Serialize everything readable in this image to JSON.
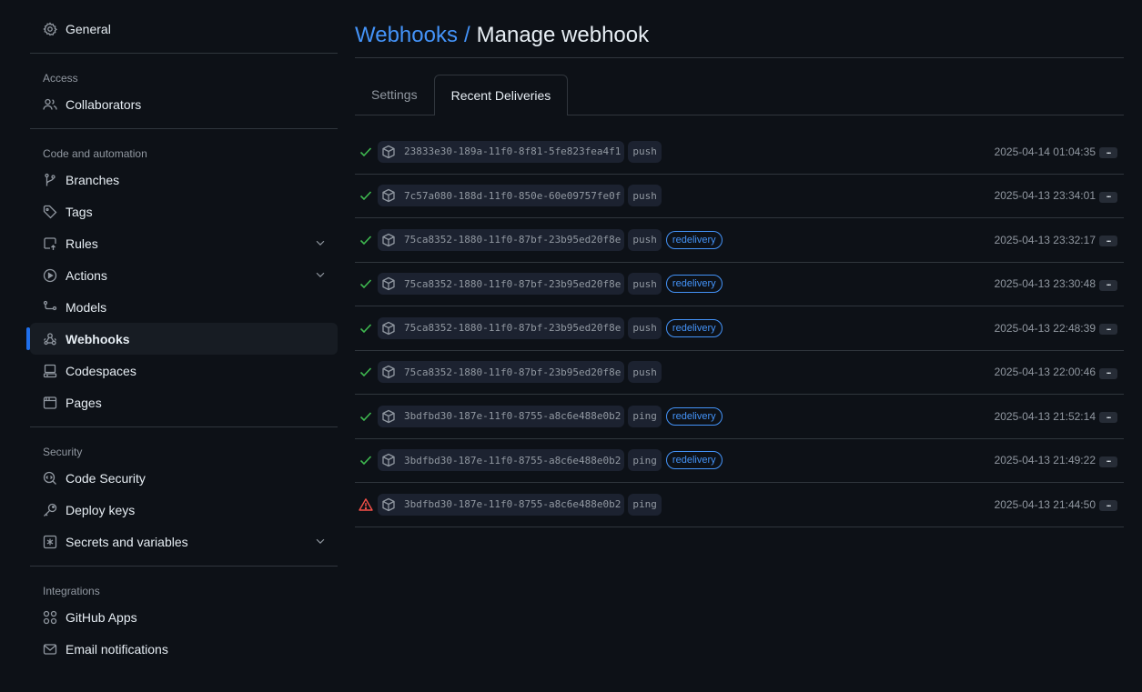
{
  "sidebar": {
    "general": {
      "label": "General",
      "icon": "gear-icon"
    },
    "sections": [
      {
        "heading": "Access",
        "items": [
          {
            "label": "Collaborators",
            "icon": "people-icon"
          }
        ]
      },
      {
        "heading": "Code and automation",
        "items": [
          {
            "label": "Branches",
            "icon": "branch-icon"
          },
          {
            "label": "Tags",
            "icon": "tag-icon"
          },
          {
            "label": "Rules",
            "icon": "rules-icon",
            "expandable": true
          },
          {
            "label": "Actions",
            "icon": "play-icon",
            "expandable": true
          },
          {
            "label": "Models",
            "icon": "models-icon"
          },
          {
            "label": "Webhooks",
            "icon": "webhook-icon",
            "active": true
          },
          {
            "label": "Codespaces",
            "icon": "codespaces-icon"
          },
          {
            "label": "Pages",
            "icon": "browser-icon"
          }
        ]
      },
      {
        "heading": "Security",
        "items": [
          {
            "label": "Code Security",
            "icon": "codescan-icon"
          },
          {
            "label": "Deploy keys",
            "icon": "key-icon"
          },
          {
            "label": "Secrets and variables",
            "icon": "asterisk-icon",
            "expandable": true
          }
        ]
      },
      {
        "heading": "Integrations",
        "items": [
          {
            "label": "GitHub Apps",
            "icon": "apps-icon"
          },
          {
            "label": "Email notifications",
            "icon": "mail-icon"
          }
        ]
      }
    ]
  },
  "header": {
    "breadcrumb": "Webhooks",
    "separator": "/",
    "title": "Manage webhook"
  },
  "tabs": [
    {
      "label": "Settings",
      "selected": false
    },
    {
      "label": "Recent Deliveries",
      "selected": true
    }
  ],
  "deliveries": [
    {
      "status": "success",
      "guid": "23833e30-189a-11f0-8f81-5fe823fea4f1",
      "event": "push",
      "redelivery": null,
      "time": "2025-04-14 01:04:35"
    },
    {
      "status": "success",
      "guid": "7c57a080-188d-11f0-850e-60e09757fe0f",
      "event": "push",
      "redelivery": null,
      "time": "2025-04-13 23:34:01"
    },
    {
      "status": "success",
      "guid": "75ca8352-1880-11f0-87bf-23b95ed20f8e",
      "event": "push",
      "redelivery": "redelivery",
      "time": "2025-04-13 23:32:17"
    },
    {
      "status": "success",
      "guid": "75ca8352-1880-11f0-87bf-23b95ed20f8e",
      "event": "push",
      "redelivery": "redelivery",
      "time": "2025-04-13 23:30:48"
    },
    {
      "status": "success",
      "guid": "75ca8352-1880-11f0-87bf-23b95ed20f8e",
      "event": "push",
      "redelivery": "redelivery",
      "time": "2025-04-13 22:48:39"
    },
    {
      "status": "success",
      "guid": "75ca8352-1880-11f0-87bf-23b95ed20f8e",
      "event": "push",
      "redelivery": null,
      "time": "2025-04-13 22:00:46"
    },
    {
      "status": "success",
      "guid": "3bdfbd30-187e-11f0-8755-a8c6e488e0b2",
      "event": "ping",
      "redelivery": "redelivery",
      "time": "2025-04-13 21:52:14"
    },
    {
      "status": "success",
      "guid": "3bdfbd30-187e-11f0-8755-a8c6e488e0b2",
      "event": "ping",
      "redelivery": "redelivery",
      "time": "2025-04-13 21:49:22"
    },
    {
      "status": "failure",
      "guid": "3bdfbd30-187e-11f0-8755-a8c6e488e0b2",
      "event": "ping",
      "redelivery": null,
      "time": "2025-04-13 21:44:50"
    }
  ],
  "more_label": "...",
  "colors": {
    "background": "#0d1117",
    "accent": "#4493f8",
    "active_indicator": "#1f6feb",
    "success": "#3fb950",
    "failure": "#f85149",
    "border": "#30363d",
    "muted": "#9198a1"
  }
}
